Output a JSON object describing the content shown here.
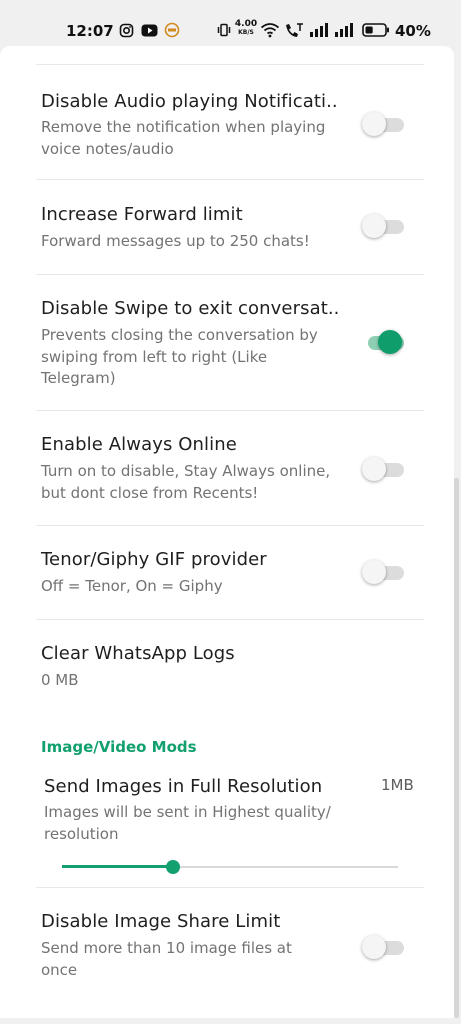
{
  "status_bar": {
    "time": "12:07",
    "net_speed_value": "4.00",
    "net_speed_unit": "KB/S",
    "battery_percent": "40%",
    "battery_level": 0.4
  },
  "settings": [
    {
      "title": "Disable Audio playing Notificati..",
      "subtitle": "Remove the notification when playing voice notes/audio",
      "enabled": false
    },
    {
      "title": "Increase Forward limit",
      "subtitle": "Forward messages up to 250 chats!",
      "enabled": false
    },
    {
      "title": "Disable Swipe to exit conversat..",
      "subtitle": "Prevents closing the conversation by swiping from left to right (Like Telegram)",
      "enabled": true
    },
    {
      "title": "Enable Always Online",
      "subtitle": "Turn on to disable, Stay Always online, but dont close from Recents!",
      "enabled": false
    },
    {
      "title": "Tenor/Giphy GIF provider",
      "subtitle": "Off = Tenor, On = Giphy",
      "enabled": false
    },
    {
      "title": "Clear WhatsApp Logs",
      "subtitle": "0 MB"
    }
  ],
  "image_video_section": {
    "header": "Image/Video Mods",
    "full_resolution": {
      "title": "Send Images in Full Resolution",
      "value": "1MB",
      "subtitle": "Images will be sent in Highest quality/ resolution",
      "slider_fraction": 0.33
    },
    "share_limit": {
      "title": "Disable Image Share Limit",
      "subtitle": "Send more than 10 image files at once",
      "enabled": false
    }
  },
  "colors": {
    "accent": "#12a06e",
    "toggle_on_track": "#8fd0b4",
    "toggle_off_track": "#dcdcdc"
  }
}
